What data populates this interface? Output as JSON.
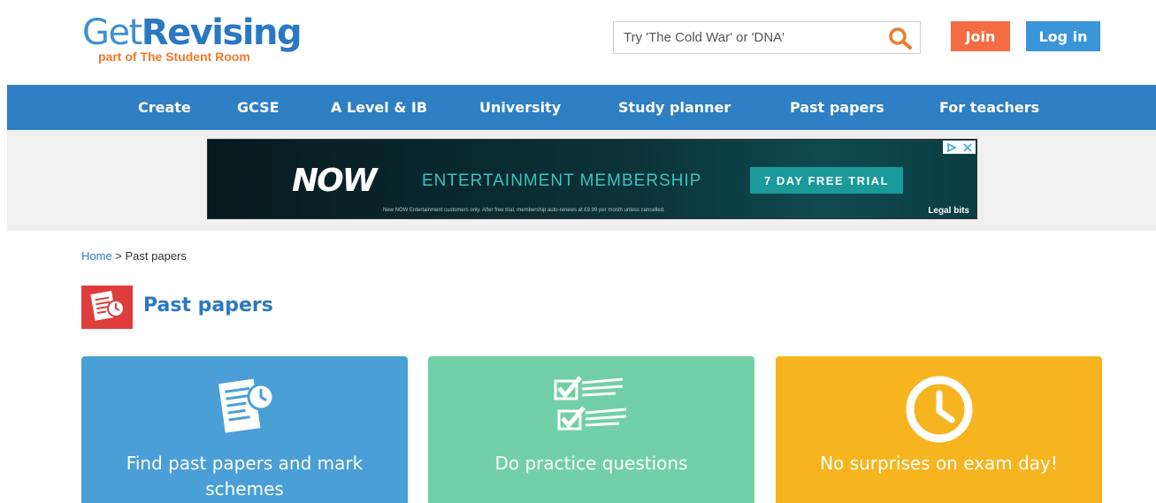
{
  "header": {
    "logo": {
      "get": "Get",
      "revising": "Revising",
      "sub": "part of The Student Room"
    },
    "search": {
      "placeholder": "Try 'The Cold War' or 'DNA'"
    },
    "join_label": "Join",
    "login_label": "Log in"
  },
  "nav": {
    "items": [
      {
        "label": "Create"
      },
      {
        "label": "GCSE"
      },
      {
        "label": "A Level & IB"
      },
      {
        "label": "University"
      },
      {
        "label": "Study planner"
      },
      {
        "label": "Past papers"
      },
      {
        "label": "For teachers"
      }
    ]
  },
  "ad": {
    "brand": "NOW",
    "headline": "ENTERTAINMENT MEMBERSHIP",
    "cta": "7 DAY FREE TRIAL",
    "fine_print": "New NOW Entertainment customers only. After free trial, membership auto-renews at £9.99 per month unless cancelled.",
    "legal": "Legal bits"
  },
  "breadcrumb": {
    "home": "Home",
    "separator": " > ",
    "current": "Past papers"
  },
  "page": {
    "title": "Past papers"
  },
  "cards": [
    {
      "label": "Find past papers and mark schemes",
      "icon": "document-clock-icon",
      "color": "#4a9fd6"
    },
    {
      "label": "Do practice questions",
      "icon": "checklist-icon",
      "color": "#71d0a5"
    },
    {
      "label": "No surprises on exam day!",
      "icon": "clock-icon",
      "color": "#f6b51f"
    }
  ],
  "colors": {
    "brand_blue": "#2e7fc4",
    "join_orange": "#f36c43",
    "login_blue": "#3a95d8",
    "logo_orange": "#f07a2a"
  }
}
